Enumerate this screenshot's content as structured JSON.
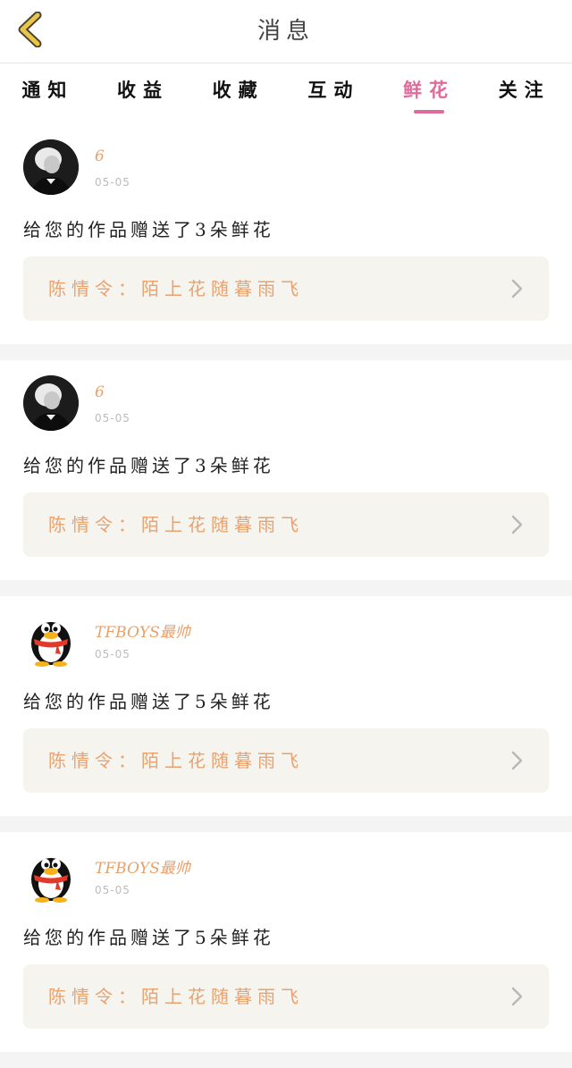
{
  "header": {
    "title": "消息"
  },
  "tabs": [
    {
      "label": "通知",
      "active": false
    },
    {
      "label": "收益",
      "active": false
    },
    {
      "label": "收藏",
      "active": false
    },
    {
      "label": "互动",
      "active": false
    },
    {
      "label": "鲜花",
      "active": true
    },
    {
      "label": "关注",
      "active": false
    }
  ],
  "messages": [
    {
      "username": "6",
      "date": "05-05",
      "avatar": "photo-avatar",
      "text": "给您的作品赠送了3朵鲜花",
      "work": "陈情令：陌上花随暮雨飞"
    },
    {
      "username": "6",
      "date": "05-05",
      "avatar": "photo-avatar",
      "text": "给您的作品赠送了3朵鲜花",
      "work": "陈情令：陌上花随暮雨飞"
    },
    {
      "username": "TFBOYS最帅",
      "date": "05-05",
      "avatar": "penguin-avatar",
      "text": "给您的作品赠送了5朵鲜花",
      "work": "陈情令：陌上花随暮雨飞"
    },
    {
      "username": "TFBOYS最帅",
      "date": "05-05",
      "avatar": "penguin-avatar",
      "text": "给您的作品赠送了5朵鲜花",
      "work": "陈情令：陌上花随暮雨飞"
    }
  ],
  "colors": {
    "accent": "#e06a9a",
    "username": "#e8a06a",
    "work_label": "#e9a26f",
    "back_icon": "#e8c64a"
  },
  "icons": {
    "back": "chevron-left-icon",
    "open_work": "chevron-right-icon"
  }
}
